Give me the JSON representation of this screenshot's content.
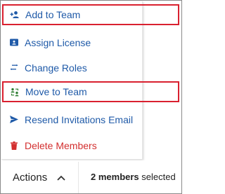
{
  "menu": {
    "items": [
      {
        "label": "Add to Team",
        "icon": "add-person-icon"
      },
      {
        "label": "Assign License",
        "icon": "license-card-icon"
      },
      {
        "label": "Change Roles",
        "icon": "swap-arrows-icon"
      },
      {
        "label": "Move to Team",
        "icon": "move-team-icon"
      },
      {
        "label": "Resend Invitations Email",
        "icon": "send-icon"
      },
      {
        "label": "Delete Members",
        "icon": "trash-icon"
      }
    ]
  },
  "footer": {
    "actions_label": "Actions",
    "selected_count": "2 members",
    "selected_suffix": " selected"
  },
  "colors": {
    "link": "#1f5aa8",
    "danger": "#d32f2f",
    "highlight_border": "#d9202f"
  }
}
